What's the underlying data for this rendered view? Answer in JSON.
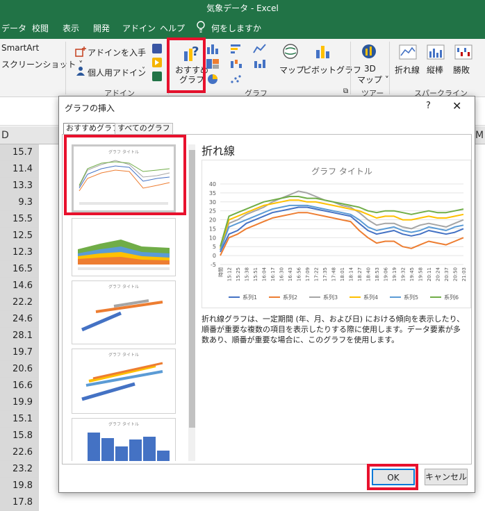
{
  "window": {
    "title": "気象データ  -  Excel"
  },
  "ribbon_tabs": [
    "データ",
    "校閲",
    "表示",
    "開発",
    "アドイン",
    "ヘルプ"
  ],
  "tell_me": "何をしますか",
  "ribbon": {
    "smartart": "SmartArt",
    "screenshot": "スクリーンショット ˅",
    "get_addins": "アドインを入手",
    "my_addins": "個人用アドイン",
    "addins_group": "アドイン",
    "recommended_chart_line1": "おすすめ",
    "recommended_chart_line2": "グラフ",
    "charts_group": "グラフ",
    "map": "マップ",
    "pivot_chart": "ピボットグラフ",
    "map3d_line1": "3D",
    "map3d_line2": "マップ ˅",
    "tours_group": "ツアー",
    "spark_line": "折れ線",
    "spark_column": "縦棒",
    "spark_winloss": "勝敗",
    "sparklines_group": "スパークライン"
  },
  "sheet": {
    "col_d": "D",
    "col_m": "M",
    "values": [
      "15.7",
      "11.4",
      "13.3",
      "9.3",
      "15.5",
      "12.5",
      "12.3",
      "16.5",
      "14.6",
      "22.2",
      "24.6",
      "28.1",
      "19.7",
      "20.6",
      "16.6",
      "19.9",
      "15.1",
      "15.8",
      "22.6",
      "23.2",
      "19.8",
      "17.8"
    ]
  },
  "dialog": {
    "title": "グラフの挿入",
    "help": "?",
    "close": "✕",
    "tab_recommended": "おすすめグラフ",
    "tab_all": "すべてのグラフ",
    "preview_name": "折れ線",
    "description": "折れ線グラフは、一定期間 (年、月、および日) における傾向を表示したり、順番が重要な複数の項目を表示したりする際に使用します。データ要素が多数あり、順番が重要な場合に、このグラフを使用します。",
    "ok": "OK",
    "cancel": "キャンセル",
    "thumb_title": "グラフ タイトル"
  },
  "chart_data": {
    "type": "line",
    "title": "グラフ タイトル",
    "ylim": [
      -5,
      40
    ],
    "yticks": [
      "40",
      "35",
      "30",
      "25",
      "20",
      "15",
      "10",
      "5",
      "0",
      "-5"
    ],
    "x_tick_labels": [
      "時間",
      "15:12",
      "15:25",
      "15:38",
      "15:51",
      "16:04",
      "16:17",
      "16:30",
      "16:43",
      "16:56",
      "17:09",
      "17:22",
      "17:35",
      "17:48",
      "18:01",
      "18:14",
      "18:27",
      "18:40",
      "18:53",
      "19:06",
      "19:19",
      "19:32",
      "19:45",
      "19:58",
      "20:11",
      "20:24",
      "20:37",
      "20:50",
      "21:03"
    ],
    "series": [
      {
        "name": "系列1",
        "color": "#4472c4",
        "values": [
          2,
          12,
          14,
          18,
          20,
          22,
          24,
          25,
          26,
          27,
          27,
          26,
          25,
          24,
          23,
          22,
          18,
          14,
          12,
          13,
          14,
          12,
          11,
          12,
          14,
          13,
          12,
          13,
          15
        ]
      },
      {
        "name": "系列2",
        "color": "#ed7d31",
        "values": [
          0,
          10,
          12,
          15,
          17,
          19,
          21,
          22,
          23,
          24,
          24,
          23,
          22,
          21,
          20,
          19,
          14,
          10,
          7,
          8,
          8,
          5,
          4,
          6,
          8,
          7,
          6,
          8,
          10
        ]
      },
      {
        "name": "系列3",
        "color": "#a5a5a5",
        "values": [
          3,
          18,
          20,
          23,
          25,
          27,
          30,
          32,
          34,
          36,
          35,
          33,
          31,
          30,
          28,
          27,
          24,
          20,
          17,
          18,
          18,
          16,
          15,
          17,
          18,
          17,
          16,
          18,
          20
        ]
      },
      {
        "name": "系列4",
        "color": "#ffc000",
        "values": [
          4,
          20,
          22,
          24,
          26,
          28,
          29,
          30,
          31,
          31,
          30,
          30,
          29,
          28,
          27,
          26,
          25,
          23,
          21,
          22,
          22,
          20,
          20,
          21,
          22,
          21,
          21,
          22,
          23
        ]
      },
      {
        "name": "系列5",
        "color": "#5b9bd5",
        "values": [
          3,
          16,
          18,
          20,
          22,
          24,
          26,
          27,
          28,
          28,
          28,
          27,
          26,
          25,
          24,
          23,
          20,
          16,
          14,
          15,
          16,
          14,
          13,
          14,
          16,
          15,
          14,
          16,
          17
        ]
      },
      {
        "name": "系列6",
        "color": "#70ad47",
        "values": [
          5,
          22,
          24,
          26,
          28,
          30,
          31,
          32,
          33,
          33,
          32,
          32,
          31,
          30,
          29,
          28,
          27,
          25,
          24,
          25,
          25,
          24,
          23,
          24,
          25,
          24,
          24,
          25,
          26
        ]
      }
    ]
  },
  "highlight_color": "#e8112d"
}
